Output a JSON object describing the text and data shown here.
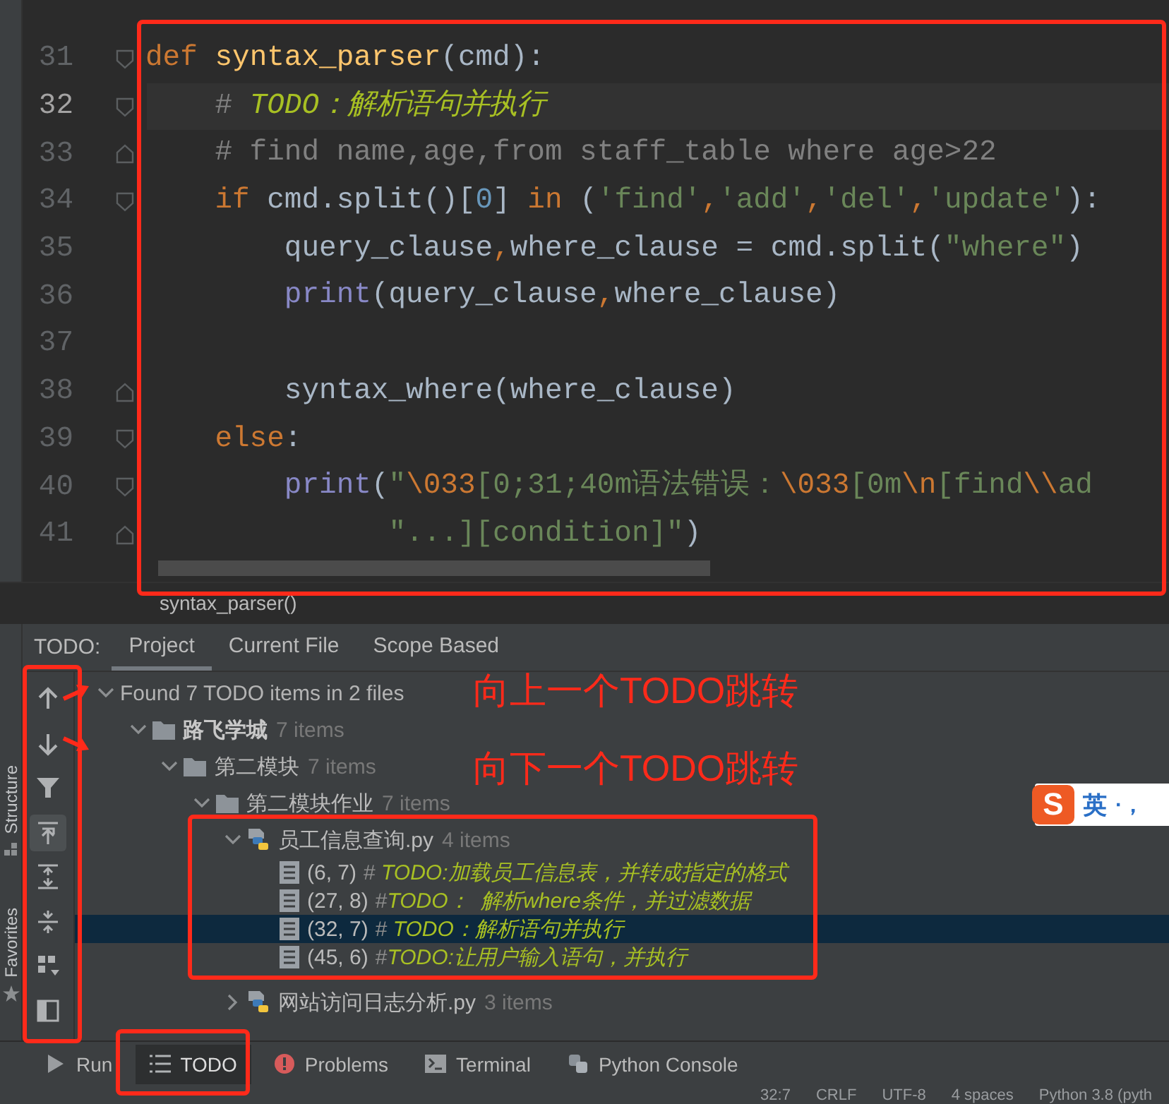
{
  "editor": {
    "lines": [
      {
        "number": "31",
        "current": false,
        "fold_open": true,
        "tokens": [
          {
            "kind": "keyword",
            "text": "def "
          },
          {
            "kind": "function",
            "text": "syntax_parser"
          },
          {
            "kind": "plain",
            "text": "(cmd):"
          }
        ]
      },
      {
        "number": "32",
        "current": true,
        "fold_open": true,
        "tokens": [
          {
            "kind": "comment",
            "text": "    # "
          },
          {
            "kind": "todo",
            "text": "TODO：解析语句并执行"
          }
        ]
      },
      {
        "number": "33",
        "current": false,
        "fold_open": false,
        "tokens": [
          {
            "kind": "comment",
            "text": "    # find name,age,from staff_table where age>22"
          }
        ]
      },
      {
        "number": "34",
        "current": false,
        "fold_open": true,
        "tokens": [
          {
            "kind": "keyword",
            "text": "    if"
          },
          {
            "kind": "plain",
            "text": " cmd.split()["
          },
          {
            "kind": "number",
            "text": "0"
          },
          {
            "kind": "plain",
            "text": "] "
          },
          {
            "kind": "keyword",
            "text": "in"
          },
          {
            "kind": "plain",
            "text": " ("
          },
          {
            "kind": "string",
            "text": "'find'"
          },
          {
            "kind": "keyword",
            "text": ","
          },
          {
            "kind": "string",
            "text": "'add'"
          },
          {
            "kind": "keyword",
            "text": ","
          },
          {
            "kind": "string",
            "text": "'del'"
          },
          {
            "kind": "keyword",
            "text": ","
          },
          {
            "kind": "string",
            "text": "'update'"
          },
          {
            "kind": "plain",
            "text": "):"
          }
        ]
      },
      {
        "number": "35",
        "current": false,
        "tokens": [
          {
            "kind": "plain",
            "text": "        query_clause"
          },
          {
            "kind": "keyword",
            "text": ","
          },
          {
            "kind": "plain",
            "text": "where_clause = cmd.split("
          },
          {
            "kind": "string",
            "text": "\"where\""
          },
          {
            "kind": "plain",
            "text": ")"
          }
        ]
      },
      {
        "number": "36",
        "current": false,
        "tokens": [
          {
            "kind": "builtin",
            "text": "        print"
          },
          {
            "kind": "plain",
            "text": "(query_clause"
          },
          {
            "kind": "keyword",
            "text": ","
          },
          {
            "kind": "plain",
            "text": "where_clause)"
          }
        ]
      },
      {
        "number": "37",
        "current": false
      },
      {
        "number": "38",
        "current": false,
        "fold_open": false,
        "tokens": [
          {
            "kind": "plain",
            "text": "        syntax_where(where_clause)"
          }
        ]
      },
      {
        "number": "39",
        "current": false,
        "fold_open": true,
        "tokens": [
          {
            "kind": "keyword",
            "text": "    else"
          },
          {
            "kind": "plain",
            "text": ":"
          }
        ]
      },
      {
        "number": "40",
        "current": false,
        "fold_open": true,
        "tokens": [
          {
            "kind": "builtin",
            "text": "        print"
          },
          {
            "kind": "plain",
            "text": "("
          },
          {
            "kind": "string",
            "text": "\""
          },
          {
            "kind": "escape",
            "text": "\\033"
          },
          {
            "kind": "string",
            "text": "[0;31;40m语法错误："
          },
          {
            "kind": "escape",
            "text": "\\033"
          },
          {
            "kind": "string",
            "text": "[0m"
          },
          {
            "kind": "escape",
            "text": "\\n"
          },
          {
            "kind": "string",
            "text": "[find"
          },
          {
            "kind": "escape",
            "text": "\\\\"
          },
          {
            "kind": "string",
            "text": "ad"
          }
        ]
      },
      {
        "number": "41",
        "current": false,
        "fold_open": false,
        "tokens": [
          {
            "kind": "string",
            "text": "              \"...][condition]\""
          },
          {
            "kind": "plain",
            "text": ")"
          }
        ]
      }
    ]
  },
  "breadcrumb": "syntax_parser()",
  "todo_panel": {
    "label": "TODO:",
    "tabs": [
      {
        "label": "Project",
        "selected": true
      },
      {
        "label": "Current File",
        "selected": false
      },
      {
        "label": "Scope Based",
        "selected": false
      }
    ],
    "toolbar": [
      {
        "kind": "up",
        "on": false
      },
      {
        "kind": "down",
        "on": false
      },
      {
        "kind": "filter",
        "on": false
      },
      {
        "kind": "autoscroll",
        "on": true
      },
      {
        "kind": "expand",
        "on": false
      },
      {
        "kind": "collapse",
        "on": false
      },
      {
        "kind": "group",
        "on": false
      },
      {
        "kind": "preview",
        "on": false
      }
    ],
    "tree": [
      {
        "kind": "summary",
        "label": "Found 7 TODO items in 2 files",
        "expanded": true,
        "selected": false,
        "children": [
          {
            "kind": "module",
            "label": "路飞学城",
            "count": "7 items",
            "expanded": true,
            "selected": false,
            "children": [
              {
                "kind": "folder",
                "label": "第二模块",
                "count": "7 items",
                "expanded": true,
                "selected": false,
                "children": [
                  {
                    "kind": "folder",
                    "label": "第二模块作业",
                    "count": "7 items",
                    "expanded": true,
                    "selected": false,
                    "children": [
                      {
                        "kind": "file",
                        "label": "员工信息查询.py",
                        "count": "4 items",
                        "expanded": true,
                        "selected": false,
                        "children": [
                          {
                            "kind": "todo",
                            "position": "(6, 7)",
                            "mark": "#",
                            "text": " TODO:加载员工信息表，并转成指定的格式",
                            "selected": false
                          },
                          {
                            "kind": "todo",
                            "position": "(27, 8)",
                            "mark": "#",
                            "text": "TODO：  解析where条件，并过滤数据",
                            "selected": false
                          },
                          {
                            "kind": "todo",
                            "position": "(32, 7)",
                            "mark": "#",
                            "text": " TODO：解析语句并执行",
                            "selected": true
                          },
                          {
                            "kind": "todo",
                            "position": "(45, 6)",
                            "mark": "#",
                            "text": "TODO:让用户输入语句，并执行",
                            "selected": false
                          }
                        ]
                      },
                      {
                        "kind": "file",
                        "label": "网站访问日志分析.py",
                        "count": "3 items",
                        "expanded": false,
                        "selected": false
                      }
                    ]
                  }
                ]
              }
            ]
          }
        ]
      }
    ]
  },
  "side_tabs": [
    {
      "label": "Structure"
    },
    {
      "label": "Favorites"
    }
  ],
  "annotations": [
    {
      "text": "向上一个TODO跳转"
    },
    {
      "text": "向下一个TODO跳转"
    }
  ],
  "ime": {
    "logo": "S",
    "mode": "英",
    "punct": "·，"
  },
  "tool_tabs": [
    {
      "kind": "run",
      "label": "Run",
      "selected": false
    },
    {
      "kind": "todo",
      "label": "TODO",
      "selected": true
    },
    {
      "kind": "problems",
      "label": "Problems",
      "selected": false
    },
    {
      "kind": "terminal",
      "label": "Terminal",
      "selected": false
    },
    {
      "kind": "python",
      "label": "Python Console",
      "selected": false
    }
  ],
  "status_bar": [
    "32:7",
    "CRLF",
    "UTF-8",
    "4 spaces",
    "Python 3.8 (pyth"
  ]
}
